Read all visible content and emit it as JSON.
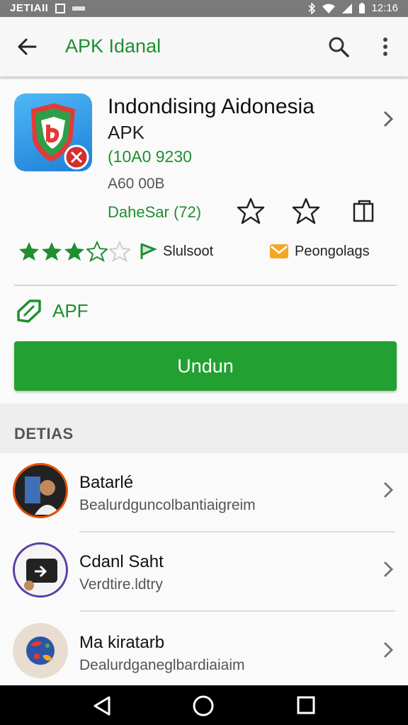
{
  "status_bar": {
    "carrier": "JETIAII",
    "time": "12:16"
  },
  "toolbar": {
    "title": "APK Idanal",
    "back_icon": "arrow-left-icon",
    "search_icon": "search-icon",
    "more_icon": "more-vertical-icon"
  },
  "app": {
    "name": "Indondising Aidonesia",
    "subtitle": "APK",
    "version": "(10A0 9230",
    "size": "A60 00B",
    "developer": "DaheSar (72)",
    "rating": 3.5,
    "meta1_label": "Slulsoot",
    "meta2_label": "Peongolags",
    "apk_label": "APF",
    "download_label": "Undun",
    "colors": {
      "accent": "#22a132",
      "green_text": "#1f8f2f",
      "meta2_icon": "#f5a623"
    }
  },
  "section": {
    "title": "DETIAS"
  },
  "list": [
    {
      "title": "Batarlé",
      "subtitle": "Bealurdguncolbantiaigreim",
      "avatar": "person-avatar"
    },
    {
      "title": "Cdanl Saht",
      "subtitle": "Verdtire.ldtry",
      "avatar": "share-box-avatar"
    },
    {
      "title": "Ma kiratarb",
      "subtitle": "Dealurdganeglbardiaiaim",
      "avatar": "colorful-ball-avatar"
    }
  ]
}
